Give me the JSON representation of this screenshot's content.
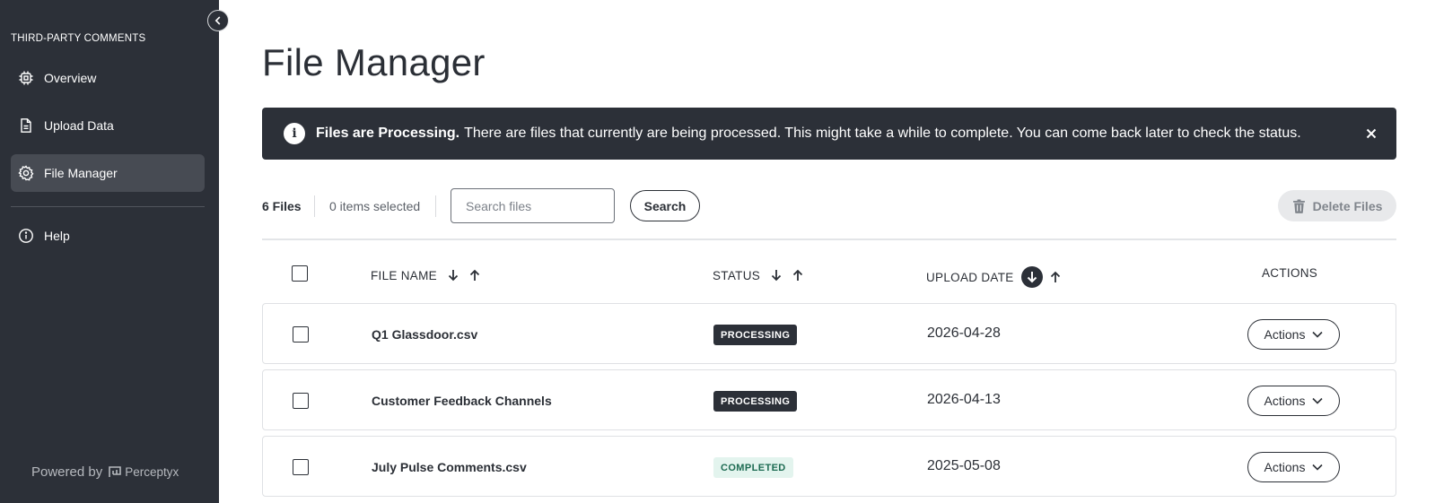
{
  "sidebar": {
    "heading": "THIRD-PARTY COMMENTS",
    "items": [
      {
        "label": "Overview",
        "icon": "chip-icon"
      },
      {
        "label": "Upload Data",
        "icon": "document-icon"
      },
      {
        "label": "File Manager",
        "icon": "gear-icon",
        "active": true
      },
      {
        "label": "Help",
        "icon": "info-icon"
      }
    ],
    "powered_by": "Powered by",
    "brand": "Perceptyx"
  },
  "page": {
    "title": "File Manager"
  },
  "banner": {
    "title": "Files are Processing.",
    "message": "There are files that currently are being processed. This might take a while to complete. You can come back later to check the status."
  },
  "toolbar": {
    "file_count": "6 Files",
    "selected_count": "0 items selected",
    "search_placeholder": "Search files",
    "search_label": "Search",
    "delete_label": "Delete Files"
  },
  "table": {
    "columns": {
      "file_name": "FILE NAME",
      "status": "STATUS",
      "upload_date": "UPLOAD DATE",
      "actions": "ACTIONS"
    },
    "sorted_by": "upload_date",
    "rows": [
      {
        "file_name": "Q1 Glassdoor.csv",
        "status": "PROCESSING",
        "upload_date": "2026-04-28",
        "actions": "Actions"
      },
      {
        "file_name": "Customer Feedback Channels",
        "status": "PROCESSING",
        "upload_date": "2026-04-13",
        "actions": "Actions"
      },
      {
        "file_name": "July Pulse Comments.csv",
        "status": "COMPLETED",
        "upload_date": "2025-05-08",
        "actions": "Actions"
      }
    ]
  },
  "colors": {
    "sidebar_bg": "#2c3038",
    "processing_badge": "#2c3038",
    "completed_badge_bg": "#e3f4ee",
    "completed_badge_text": "#1d6b52"
  }
}
